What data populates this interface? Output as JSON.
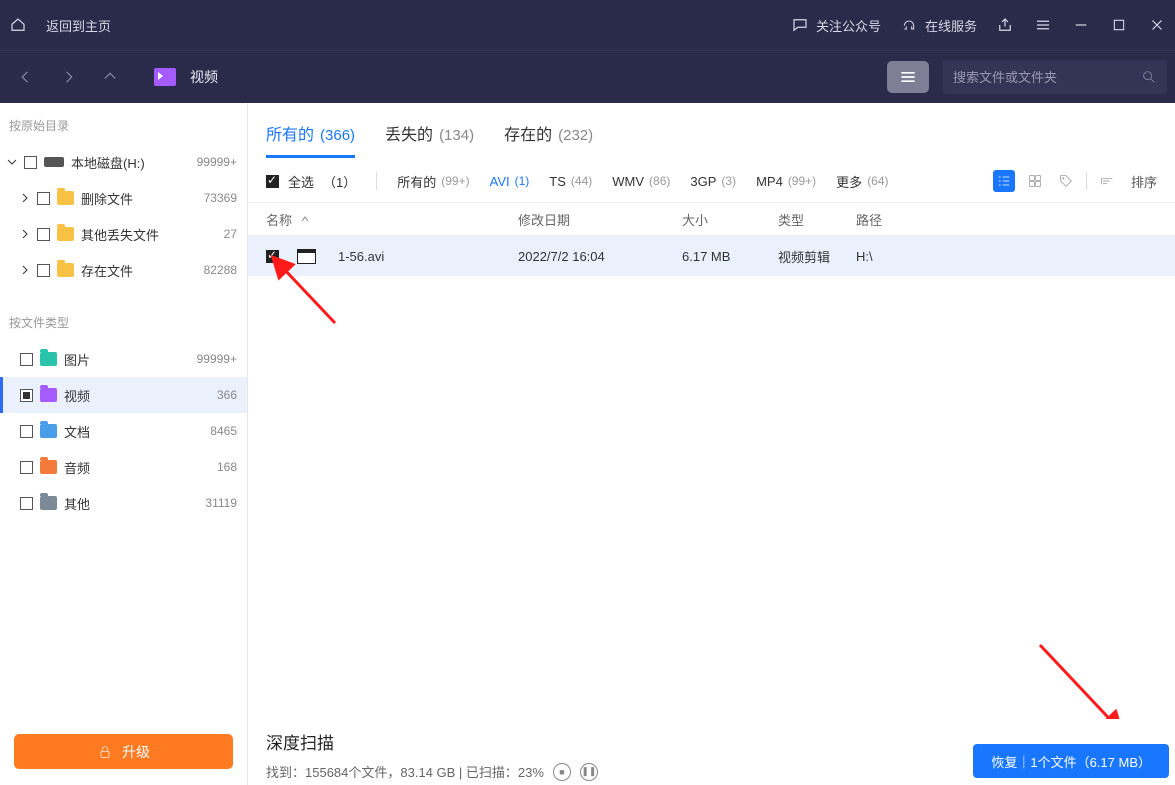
{
  "titlebar": {
    "back_home": "返回到主页",
    "follow": "关注公众号",
    "service": "在线服务"
  },
  "nav": {
    "location": "视频",
    "search_placeholder": "搜索文件或文件夹"
  },
  "sidebar": {
    "section1": "按原始目录",
    "tree": [
      {
        "label": "本地磁盘(H:)",
        "count": "99999+"
      },
      {
        "label": "删除文件",
        "count": "73369"
      },
      {
        "label": "其他丢失文件",
        "count": "27"
      },
      {
        "label": "存在文件",
        "count": "82288"
      }
    ],
    "section2": "按文件类型",
    "types": [
      {
        "label": "图片",
        "count": "99999+"
      },
      {
        "label": "视频",
        "count": "366"
      },
      {
        "label": "文档",
        "count": "8465"
      },
      {
        "label": "音频",
        "count": "168"
      },
      {
        "label": "其他",
        "count": "31119"
      }
    ],
    "upgrade": "升级"
  },
  "tabs": [
    {
      "label": "所有的",
      "count": "(366)"
    },
    {
      "label": "丢失的",
      "count": "(134)"
    },
    {
      "label": "存在的",
      "count": "(232)"
    }
  ],
  "filters": {
    "select_all": "全选",
    "select_count": "（1）",
    "chips": [
      {
        "label": "所有的",
        "badge": "(99+)"
      },
      {
        "label": "AVI",
        "badge": "(1)"
      },
      {
        "label": "TS",
        "badge": "(44)"
      },
      {
        "label": "WMV",
        "badge": "(86)"
      },
      {
        "label": "3GP",
        "badge": "(3)"
      },
      {
        "label": "MP4",
        "badge": "(99+)"
      },
      {
        "label": "更多",
        "badge": "(64)"
      }
    ],
    "sort_label": "排序"
  },
  "columns": {
    "name": "名称",
    "date": "修改日期",
    "size": "大小",
    "type": "类型",
    "path": "路径"
  },
  "rows": [
    {
      "name": "1-56.avi",
      "date": "2022/7/2 16:04",
      "size": "6.17 MB",
      "type": "视频剪辑",
      "path": "H:\\"
    }
  ],
  "footer": {
    "title": "深度扫描",
    "stats": "找到：155684个文件，83.14 GB | 已扫描：23%",
    "recover": "恢复｜1个文件（6.17 MB）"
  }
}
